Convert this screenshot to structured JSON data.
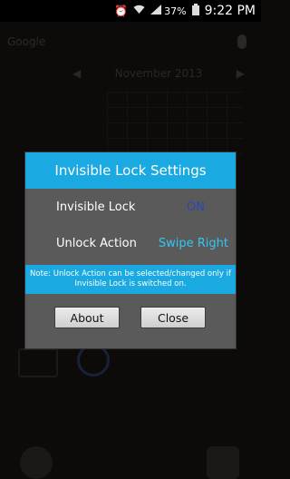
{
  "status_bar": {
    "battery_percent": "37%",
    "time": "9:22 PM"
  },
  "background": {
    "search_label": "Google",
    "calendar_month": "November 2013"
  },
  "dialog": {
    "title": "Invisible Lock Settings",
    "rows": [
      {
        "label": "Invisible Lock",
        "value": "ON"
      },
      {
        "label": "Unlock Action",
        "value": "Swipe Right"
      }
    ],
    "note": "Note: Unlock Action can be selected/changed only if Invisible Lock is switched on.",
    "buttons": {
      "about": "About",
      "close": "Close"
    }
  },
  "colors": {
    "accent": "#1aa9e1",
    "dialog_body": "#5a5a5a",
    "on_value": "#2b48b8",
    "swipe_value": "#35c6f4"
  }
}
